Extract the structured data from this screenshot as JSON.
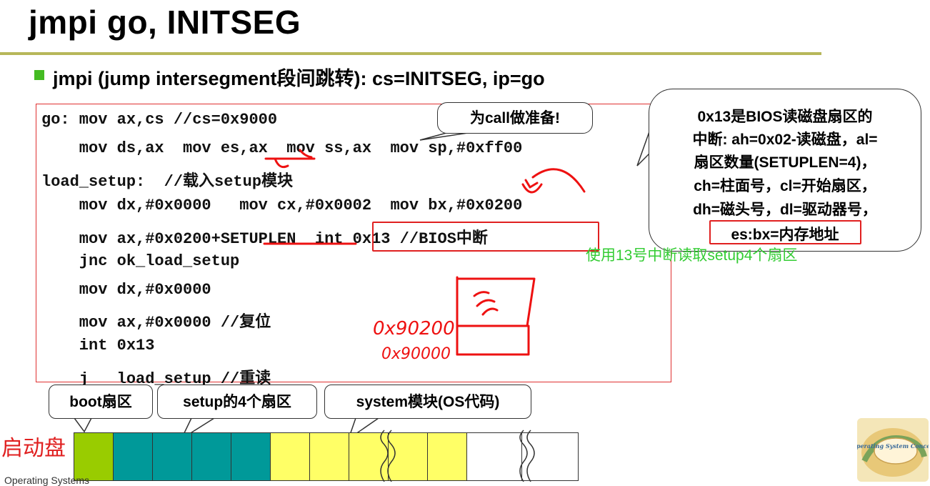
{
  "title": "jmpi go, INITSEG",
  "bullet": "jmpi (jump intersegment段间跳转): cs=INITSEG, ip=go",
  "code_lines": [
    "go: mov ax,cs //cs=0x9000",
    "    mov ds,ax  mov es,ax  mov ss,ax  mov sp,#0xff00",
    "load_setup:  //载入setup模块",
    "    mov dx,#0x0000   mov cx,#0x0002  mov bx,#0x0200",
    "    mov ax,#0x0200+SETUPLEN  int 0x13 //BIOS中断",
    "    jnc ok_load_setup",
    "    mov dx,#0x0000",
    "    mov ax,#0x0000 //复位",
    "    int 0x13",
    "    j   load_setup //重读"
  ],
  "callout_call": "为call做准备!",
  "callout_bios": [
    "0x13是BIOS读磁盘扇区的",
    "中断: ah=0x02-读磁盘，al=",
    "扇区数量(SETUPLEN=4)，",
    "ch=柱面号，cl=开始扇区，",
    "dh=磁头号，dl=驱动器号，",
    "es:bx=内存地址"
  ],
  "green_note": "使用13号中断读取setup4个扇区",
  "handwriting": {
    "addr_top": "0x90200",
    "addr_bottom": "0x90000"
  },
  "disk": {
    "label": "启动盘",
    "labels": [
      "boot扇区",
      "setup的4个扇区",
      "system模块(OS代码)"
    ],
    "colors": {
      "boot": "#99cc00",
      "setup": "#009999",
      "system": "#ffff66",
      "empty": "#ffffff"
    }
  },
  "footer": "Operating Systems",
  "logo_text": "Operating System Concepts"
}
